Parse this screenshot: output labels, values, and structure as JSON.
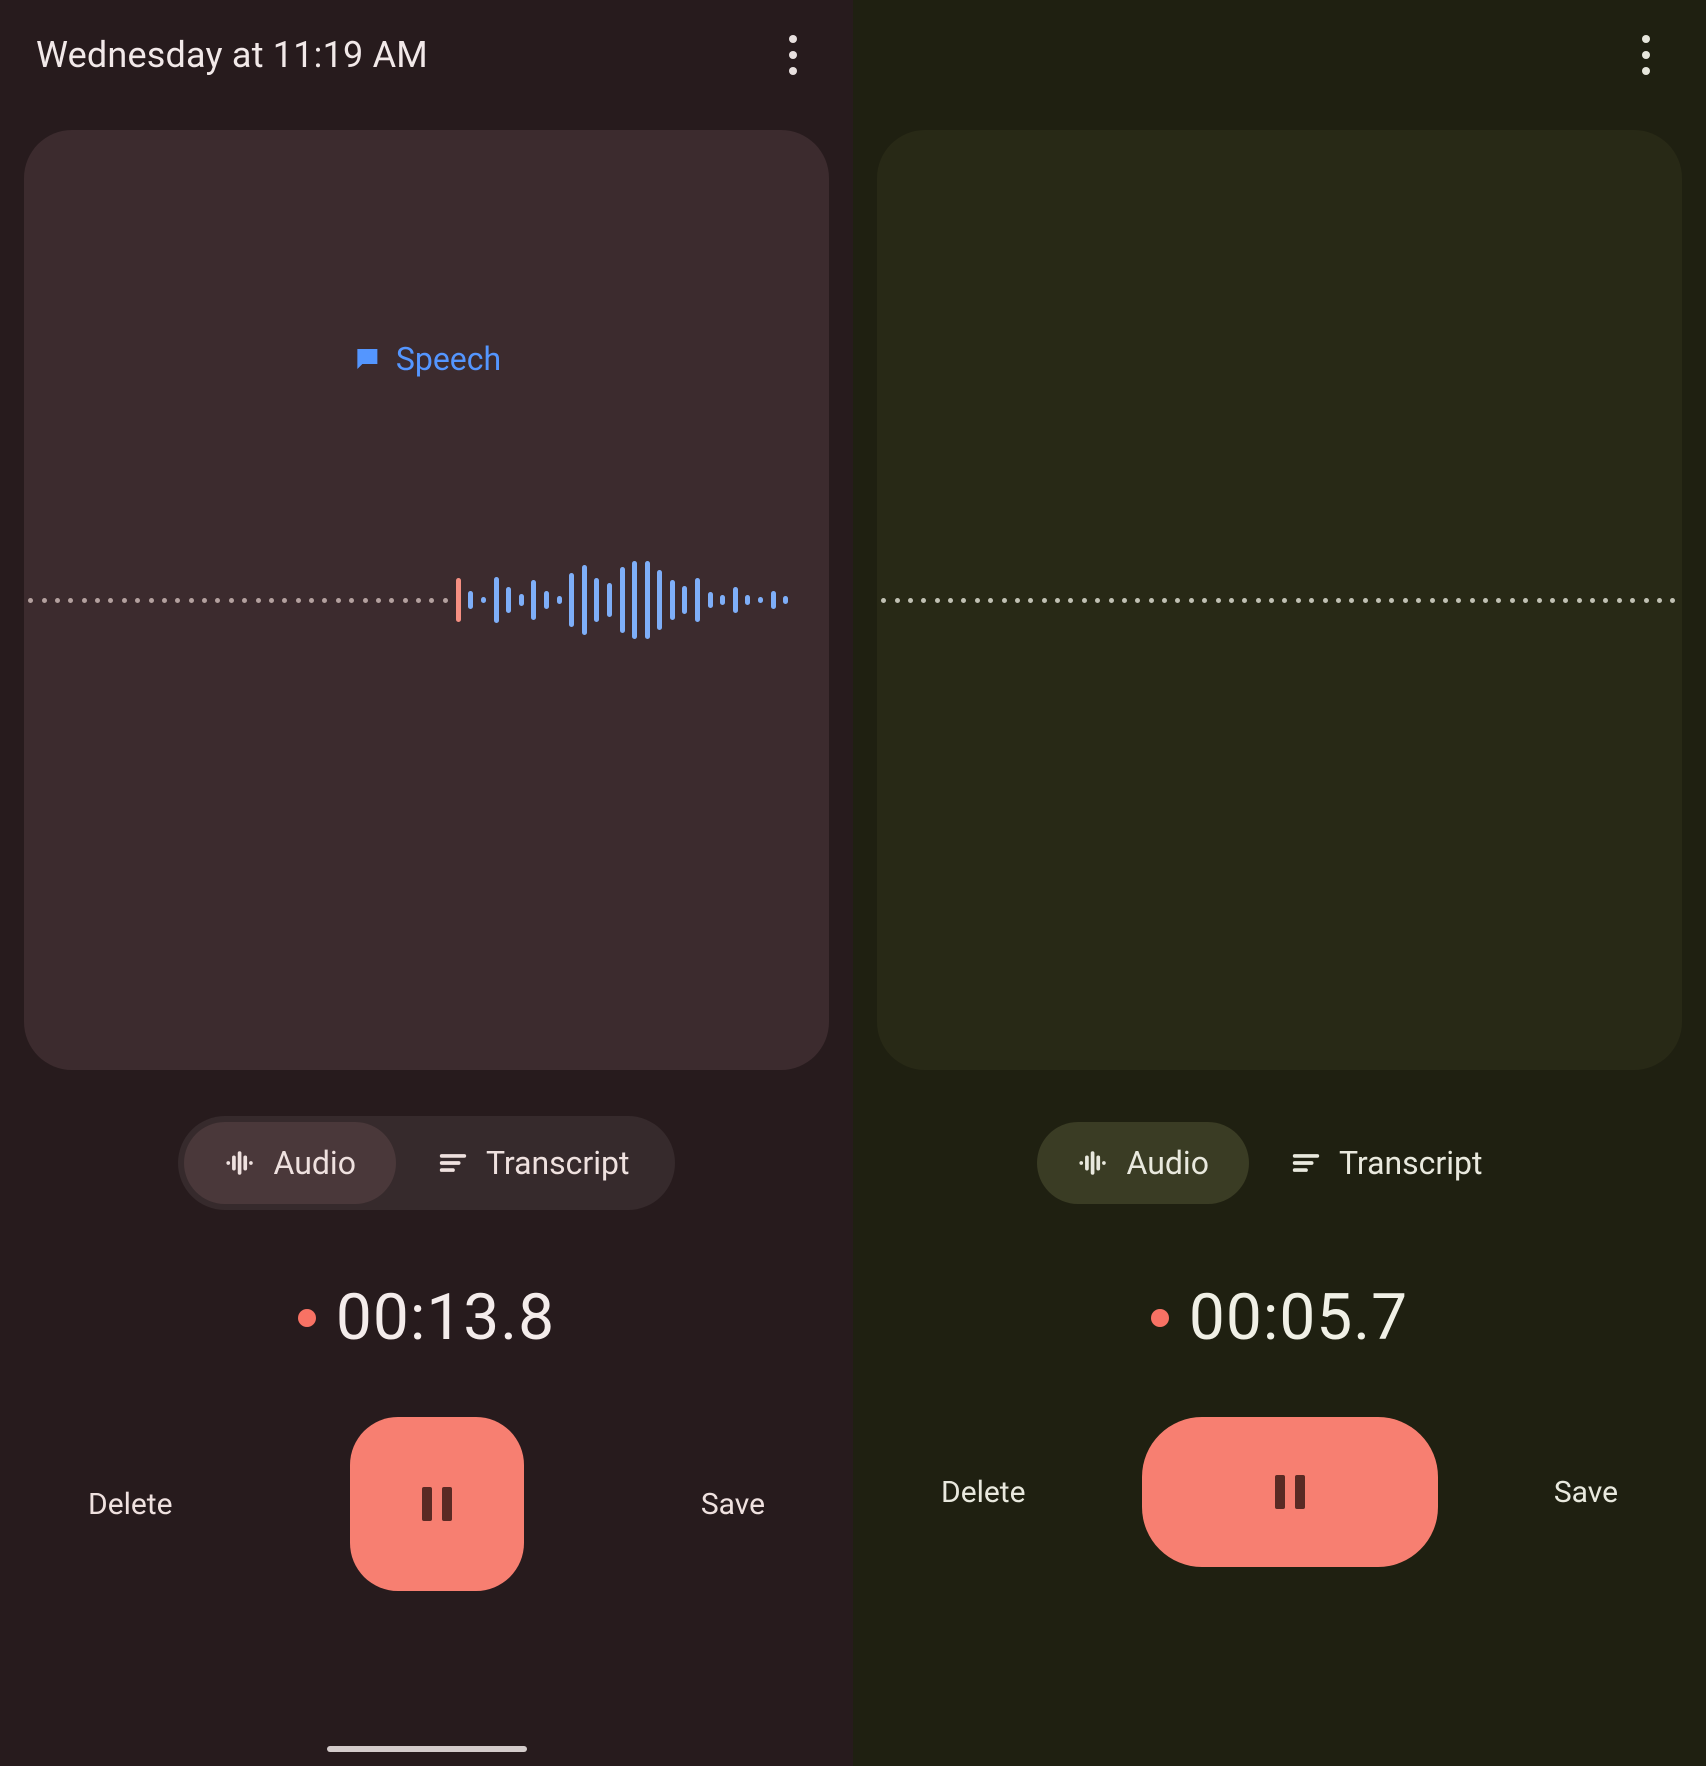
{
  "left": {
    "title": "Wednesday at 11:19 AM",
    "speechTag": "Speech",
    "tabs": {
      "audio": "Audio",
      "transcript": "Transcript",
      "active": "audio"
    },
    "timer": "00:13.8",
    "buttons": {
      "delete": "Delete",
      "save": "Save"
    },
    "waveform": {
      "dotsBefore": 32,
      "pink": [
        44
      ],
      "blue": [
        18,
        6,
        46,
        26,
        12,
        40,
        18,
        8,
        54,
        70,
        44,
        34,
        66,
        78,
        78,
        60,
        40,
        28,
        44,
        16,
        10,
        26,
        10,
        6,
        18,
        8
      ]
    },
    "colors": {
      "bg": "#271b1d",
      "panel": "#3c2b2e",
      "accent": "#f77f71",
      "wave": "#7eaef8",
      "speech": "#5496ff"
    },
    "pauseShape": "square"
  },
  "right": {
    "title": "",
    "tabs": {
      "audio": "Audio",
      "transcript": "Transcript",
      "active": "audio"
    },
    "timer": "00:05.7",
    "buttons": {
      "delete": "Delete",
      "save": "Save"
    },
    "waveform": {
      "dotsBefore": 60,
      "pink": [],
      "blue": []
    },
    "colors": {
      "bg": "#1f2011",
      "panel": "#282916",
      "accent": "#f77f71"
    },
    "pauseShape": "pill"
  }
}
